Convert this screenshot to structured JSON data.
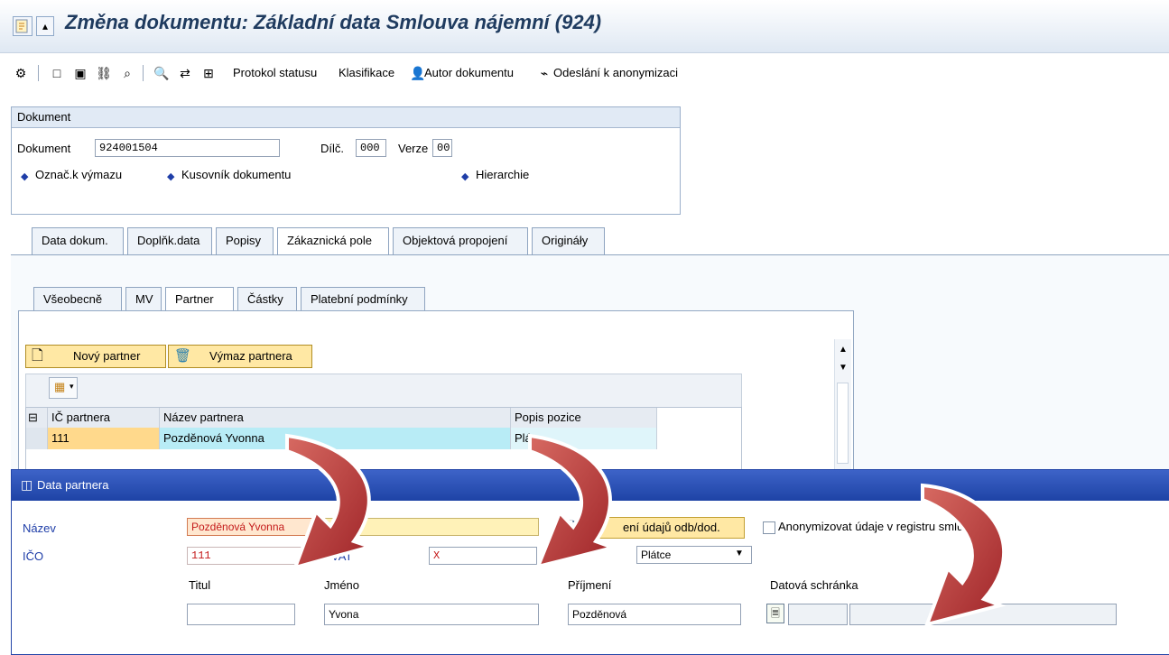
{
  "window": {
    "title": "Změna dokumentu: Základní data Smlouva nájemní (924)"
  },
  "toolbar": {
    "items": [
      {
        "label": "Protokol statusu"
      },
      {
        "label": "Klasifikace"
      },
      {
        "label": "Autor dokumentu"
      },
      {
        "label": "Odeslání k anonymizaci"
      }
    ]
  },
  "document_group": {
    "title": "Dokument",
    "document_label": "Dokument",
    "document_value": "924001504",
    "dilc_label": "Dílč.",
    "dilc_value": "000",
    "verze_label": "Verze",
    "verze_value": "00",
    "links": {
      "delete_flag": "Označ.k výmazu",
      "bom": "Kusovník dokumentu",
      "hierarchy": "Hierarchie"
    }
  },
  "main_tabs": [
    {
      "label": "Data dokum."
    },
    {
      "label": "Doplňk.data"
    },
    {
      "label": "Popisy"
    },
    {
      "label": "Zákaznická pole"
    },
    {
      "label": "Objektová propojení"
    },
    {
      "label": "Origináły"
    }
  ],
  "sub_tabs": [
    {
      "label": "Všeobecně"
    },
    {
      "label": "MV"
    },
    {
      "label": "Partner"
    },
    {
      "label": "Částky"
    },
    {
      "label": "Platební podmínky"
    }
  ],
  "partner_section": {
    "buttons": {
      "new_partner": "Nový partner",
      "delete_partner": "Výmaz partnera"
    },
    "table": {
      "columns": [
        "IČ partnera",
        "Název partnera",
        "Popis pozice"
      ],
      "rows": [
        [
          "111",
          "Pozděnová Yvonna",
          "Plát"
        ]
      ]
    }
  },
  "dialog": {
    "title": "Data partnera",
    "nazev_label": "Název",
    "nazev_value": "Pozděnová Yvonna",
    "ico_label": "IČO",
    "ico_value": "111",
    "vat_label": "VAT",
    "vat_value": "X",
    "platce_value": "Plátce",
    "zeni_udaju_button": "ení údajů odb/dod.",
    "anonymize_label": "Anonymizovat údaje v registru smlu.",
    "titul_label": "Titul",
    "titul_value": "",
    "jmeno_label": "Jméno",
    "jmeno_value": "Yvona",
    "prijmeni_label": "Příjmení",
    "prijmeni_value": "Pozděnová",
    "datova_schranka_label": "Datová schránka",
    "datova_schranka_value": ""
  },
  "colors": {
    "title_blue": "#1f3b5f",
    "dialog_header": "#2b4fb6",
    "required_red": "#c41a1a",
    "yellow_button": "#ffe8a4",
    "table_highlight": "#b8ecf6",
    "arrow_red": "#b23235"
  }
}
